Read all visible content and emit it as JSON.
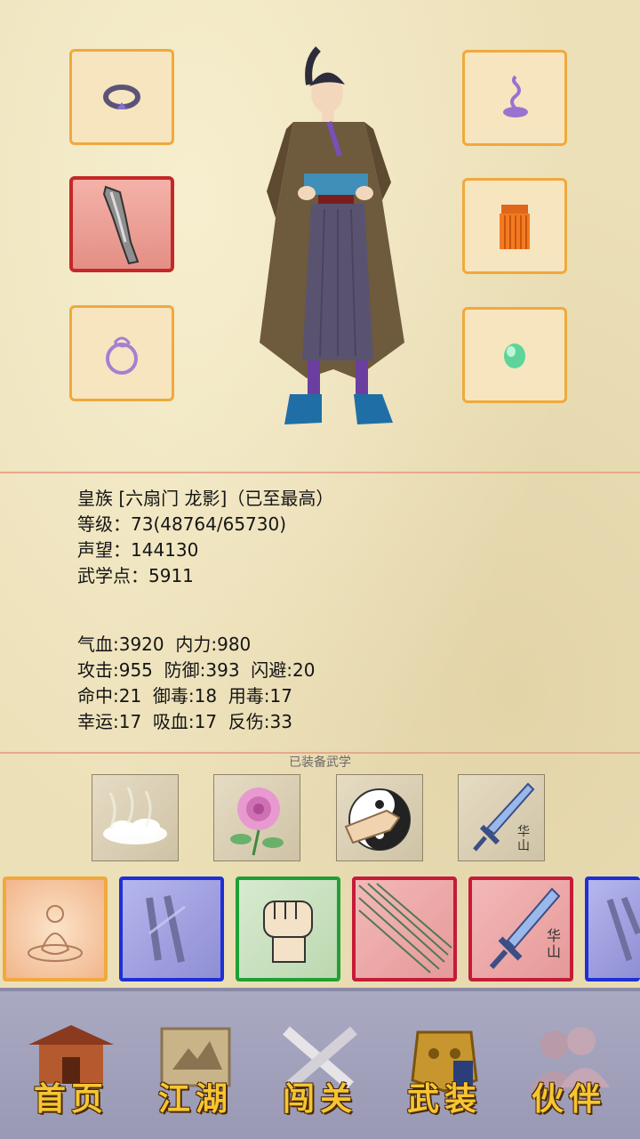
{
  "character": {
    "title": "皇族 [六扇门 龙影]（已至最高）",
    "level": "等级：73(48764/65730)",
    "fame": "声望：144130",
    "martial_points": "武学点：5911"
  },
  "stats": {
    "line1": "气血:3920  内力:980",
    "line2": "攻击:955  防御:393  闪避:20",
    "line3": "命中:21  御毒:18  用毒:17",
    "line4": "幸运:17  吸血:17  反伤:33"
  },
  "skills": {
    "equipped_label": "已装备武学",
    "huashan_tag": "华山"
  },
  "nav": {
    "home": "首页",
    "jianghu": "江湖",
    "challenge": "闯关",
    "gear": "武装",
    "partner": "伙伴"
  },
  "colors": {
    "slot_border": "#f0a93c",
    "selected_border": "#c42828",
    "nav_text": "#f7c531"
  }
}
